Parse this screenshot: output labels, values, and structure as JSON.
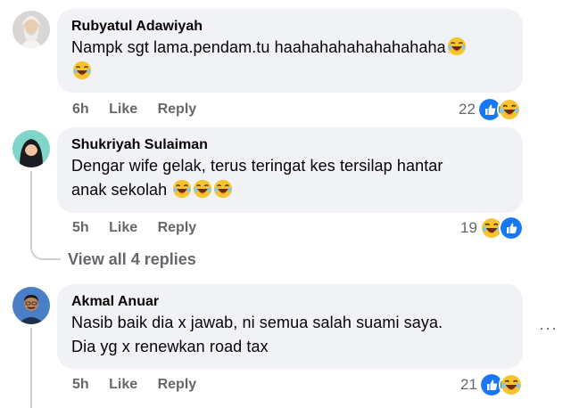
{
  "comments": [
    {
      "author": "Rubyatul Adawiyah",
      "text": "Nampk sgt lama.pendam.tu haahahahahahahahaha",
      "time": "6h",
      "like": "Like",
      "reply": "Reply",
      "reaction_count": "22",
      "reactions": [
        "like-icon",
        "haha-icon"
      ]
    },
    {
      "author": "Shukriyah Sulaiman",
      "text_line1": "Dengar wife gelak, terus teringat kes tersilap hantar",
      "text_line2": "anak sekolah",
      "time": "5h",
      "like": "Like",
      "reply": "Reply",
      "reaction_count": "19",
      "reactions": [
        "haha-icon",
        "like-icon"
      ]
    },
    {
      "author": "Akmal Anuar",
      "text_line1": "Nasib baik dia x jawab, ni semua salah suami saya.",
      "text_line2": "Dia yg x renewkan road tax",
      "time": "5h",
      "like": "Like",
      "reply": "Reply",
      "reaction_count": "21",
      "reactions": [
        "like-icon",
        "haha-icon"
      ]
    }
  ],
  "view_replies": "View all 4 replies",
  "more_options": "···",
  "colors": {
    "bubble": "#f0f2f5",
    "meta_text": "#65676b",
    "like_blue": "#1877f2",
    "haha_yellow": "#f7c42f"
  }
}
